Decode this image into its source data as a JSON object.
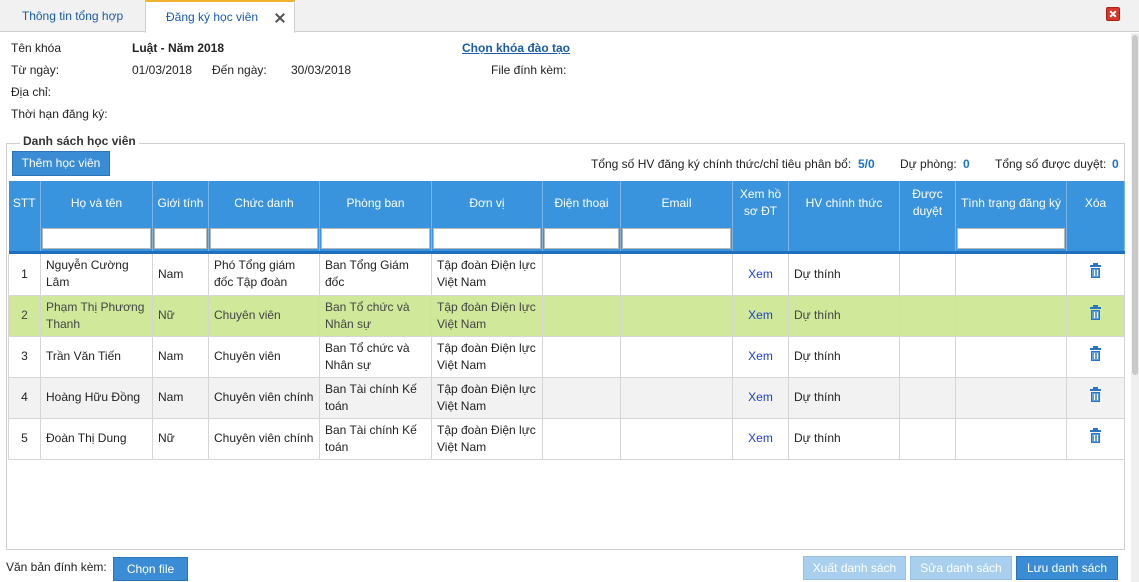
{
  "tabs": [
    {
      "label": "Thông tin tổng hợp"
    },
    {
      "label": "Đăng ký học viên"
    }
  ],
  "info": {
    "course_label": "Tên khóa",
    "course_value": "Luật - Năm 2018",
    "choose_course_link": "Chọn khóa đào tạo",
    "from_label": "Từ ngày:",
    "from_value": "01/03/2018",
    "to_label": "Đến ngày:",
    "to_value": "30/03/2018",
    "attach_label": "File đính kèm:",
    "address_label": "Địa chỉ:",
    "deadline_label": "Thời hạn đăng ký:"
  },
  "student_section": {
    "legend": "Danh sách học viên",
    "add_button": "Thêm học viên",
    "stat_official_label": "Tổng số HV đăng ký chính thức/chỉ tiêu phân bổ:",
    "stat_official_value": "5/0",
    "stat_reserve_label": "Dự phòng:",
    "stat_reserve_value": "0",
    "stat_approved_label": "Tổng số được duyệt:",
    "stat_approved_value": "0"
  },
  "table": {
    "headers": [
      "STT",
      "Họ và tên",
      "Giới tính",
      "Chức danh",
      "Phòng ban",
      "Đơn vị",
      "Điện thoại",
      "Email",
      "Xem hồ sơ ĐT",
      "HV chính thức",
      "Được duyệt",
      "Tình trạng đăng ký",
      "Xóa"
    ],
    "rows": [
      {
        "stt": "1",
        "name": "Nguyễn Cường Lâm",
        "gender": "Nam",
        "title": "Phó Tổng giám đốc Tập đoàn",
        "dept": "Ban Tổng Giám đốc",
        "unit": "Tập đoàn Điện lực Việt Nam",
        "phone": "",
        "email": "",
        "view": "Xem",
        "official": "Dự thính",
        "approved": "",
        "status": ""
      },
      {
        "stt": "2",
        "name": "Phạm Thị Phương Thanh",
        "gender": "Nữ",
        "title": "Chuyên viên",
        "dept": "Ban Tổ chức và Nhân sự",
        "unit": "Tập đoàn Điện lực Việt Nam",
        "phone": "",
        "email": "",
        "view": "Xem",
        "official": "Dự thính",
        "approved": "",
        "status": ""
      },
      {
        "stt": "3",
        "name": "Trần Văn Tiến",
        "gender": "Nam",
        "title": "Chuyên viên",
        "dept": "Ban Tổ chức và Nhân sự",
        "unit": "Tập đoàn Điện lực Việt Nam",
        "phone": "",
        "email": "",
        "view": "Xem",
        "official": "Dự thính",
        "approved": "",
        "status": ""
      },
      {
        "stt": "4",
        "name": "Hoàng Hữu Đồng",
        "gender": "Nam",
        "title": "Chuyên viên chính",
        "dept": "Ban Tài chính Kế toán",
        "unit": "Tập đoàn Điện lực Việt Nam",
        "phone": "",
        "email": "",
        "view": "Xem",
        "official": "Dự thính",
        "approved": "",
        "status": ""
      },
      {
        "stt": "5",
        "name": "Đoàn Thị Dung",
        "gender": "Nữ",
        "title": "Chuyên viên chính",
        "dept": "Ban Tài chính Kế toán",
        "unit": "Tập đoàn Điện lực Việt Nam",
        "phone": "",
        "email": "",
        "view": "Xem",
        "official": "Dự thính",
        "approved": "",
        "status": ""
      }
    ]
  },
  "footer": {
    "attach_doc_label": "Văn bản đính kèm:",
    "choose_file_button": "Chọn file",
    "export_button": "Xuất danh sách",
    "edit_button": "Sửa danh sách",
    "save_button": "Lưu danh sách"
  },
  "colors": {
    "header_blue": "#3a93dd",
    "highlight_row": "#cfe89a",
    "link_blue": "#1a5ca8",
    "close_red": "#d9362b"
  }
}
